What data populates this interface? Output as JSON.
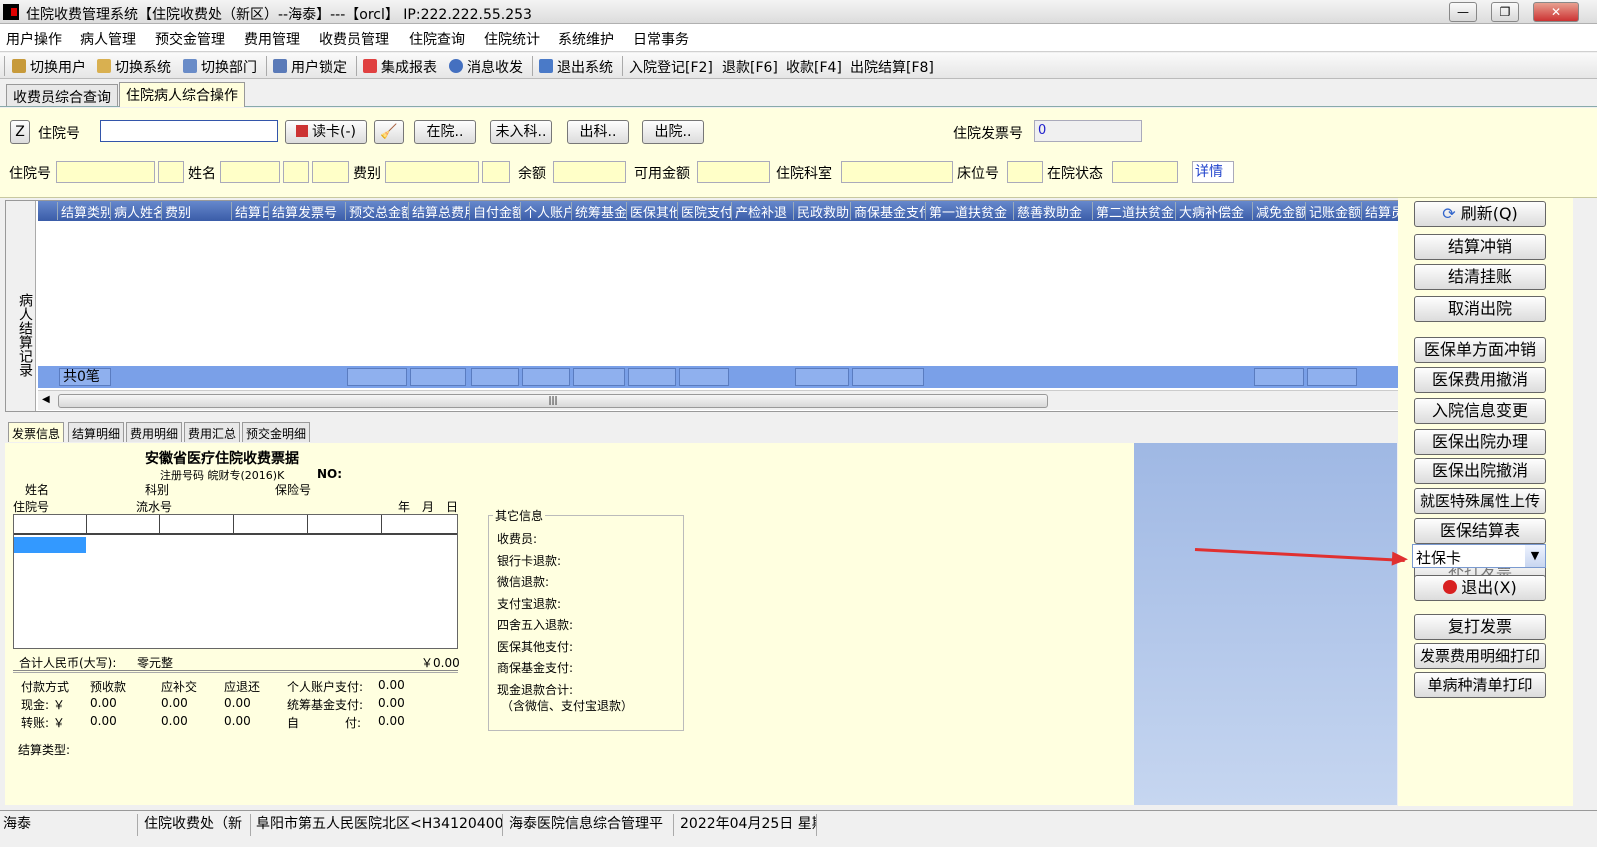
{
  "window": {
    "title": "住院收费管理系统【住院收费处（新区）--海泰】---【orcl】 IP:222.222.55.253"
  },
  "menu": [
    "用户操作",
    "病人管理",
    "预交金管理",
    "费用管理",
    "收费员管理",
    "住院查询",
    "住院统计",
    "系统维护",
    "日常事务"
  ],
  "toolbar": {
    "switch_user": "切换用户",
    "switch_system": "切换系统",
    "switch_dept": "切换部门",
    "lock_user": "用户锁定",
    "report": "集成报表",
    "message": "消息收发",
    "exit_system": "退出系统",
    "admit": "入院登记[F2]",
    "refund": "退款[F6]",
    "collect": "收款[F4]",
    "discharge_settle": "出院结算[F8]"
  },
  "tabs": {
    "tab1": "收费员综合查询",
    "tab2": "住院病人综合操作"
  },
  "search": {
    "z_label": "Z",
    "inpatient_no_label": "住院号",
    "inpatient_no_value": "",
    "read_card": "读卡(-)",
    "in_hospital": "在院..",
    "not_admitted": "未入科..",
    "out_dept": "出科..",
    "discharged": "出院..",
    "invoice_no_label": "住院发票号",
    "invoice_no_value": "0"
  },
  "patient": {
    "inpatient_no": "住院号",
    "name": "姓名",
    "fee_type": "费别",
    "balance": "余额",
    "available": "可用金额",
    "dept": "住院科室",
    "bed": "床位号",
    "status": "在院状态",
    "details": "详情"
  },
  "grid": {
    "side_label": "病人结算记录",
    "columns": [
      "结算类别",
      "病人姓名",
      "费别",
      "结算日期",
      "结算发票号",
      "预交总金额",
      "结算总费用",
      "自付金额",
      "个人账户",
      "统筹基金",
      "医保其他",
      "医院支付",
      "产检补退",
      "民政救助",
      "商保基金支付",
      "第一道扶贫金",
      "慈善救助金",
      "第二道扶贫金",
      "大病补偿金",
      "减免金额",
      "记账金额",
      "结算员"
    ],
    "footer_count": "共0笔"
  },
  "bottom_tabs": [
    "发票信息",
    "结算明细",
    "费用明细",
    "费用汇总",
    "预交金明细"
  ],
  "invoice": {
    "title": "安徽省医疗住院收费票据",
    "reg_no": "注册号码 皖财专(2016)K",
    "no_label": "NO:",
    "name": "姓名",
    "fee_type": "科别",
    "insurance_no": "保险号",
    "inpatient_no": "住院号",
    "serial_no": "流水号",
    "year": "年",
    "month": "月",
    "day": "日",
    "total_label": "合计人民币(大写):",
    "total_words": "零元整",
    "total_amount": "￥0.00",
    "pay_method": "付款方式",
    "prepaid": "预收款",
    "supplement": "应补交",
    "refund": "应退还",
    "personal_account": "个人账户支付:",
    "personal_account_val": "0.00",
    "cash": "现金: ￥",
    "cash_prepaid": "0.00",
    "cash_supp": "0.00",
    "cash_refund": "0.00",
    "pool_fund": "统筹基金支付:",
    "pool_fund_val": "0.00",
    "transfer": "转账: ￥",
    "trans_prepaid": "0.00",
    "trans_supp": "0.00",
    "trans_refund": "0.00",
    "self_pay_a": "自",
    "self_pay_b": "付:",
    "self_pay_val": "0.00",
    "settle_type": "结算类型:"
  },
  "other_info": {
    "title": "其它信息",
    "items": [
      "收费员:",
      "银行卡退款:",
      "微信退款:",
      "支付宝退款:",
      "四舍五入退款:",
      "医保其他支付:",
      "商保基金支付:",
      "现金退款合计:",
      "（含微信、支付宝退款）"
    ]
  },
  "right_buttons": {
    "refresh": "刷新(Q)",
    "settle_reverse": "结算冲销",
    "clear_hold": "结清挂账",
    "cancel_discharge": "取消出院",
    "ins_unilateral": "医保单方面冲销",
    "ins_fee_revoke": "医保费用撤消",
    "admission_change": "入院信息变更",
    "ins_discharge": "医保出院办理",
    "ins_discharge_revoke": "医保出院撤消",
    "special_upload": "就医特殊属性上传",
    "ins_settle_table": "医保结算表",
    "card_select": "社保卡",
    "print_invoice_hidden": "补打发票",
    "exit": "退出(X)",
    "reprint": "复打发票",
    "invoice_detail_print": "发票费用明细打印",
    "single_disease_print": "单病种清单打印"
  },
  "statusbar": {
    "user": "海泰",
    "office": "住院收费处（新",
    "hospital": "阜阳市第五人民医院北区<H341204000",
    "system": "海泰医院信息综合管理平",
    "date": "2022年04月25日  星期"
  },
  "colors": {
    "accent": "#3a5ca8",
    "panel": "#ffffe0",
    "arrow": "#e03030"
  }
}
